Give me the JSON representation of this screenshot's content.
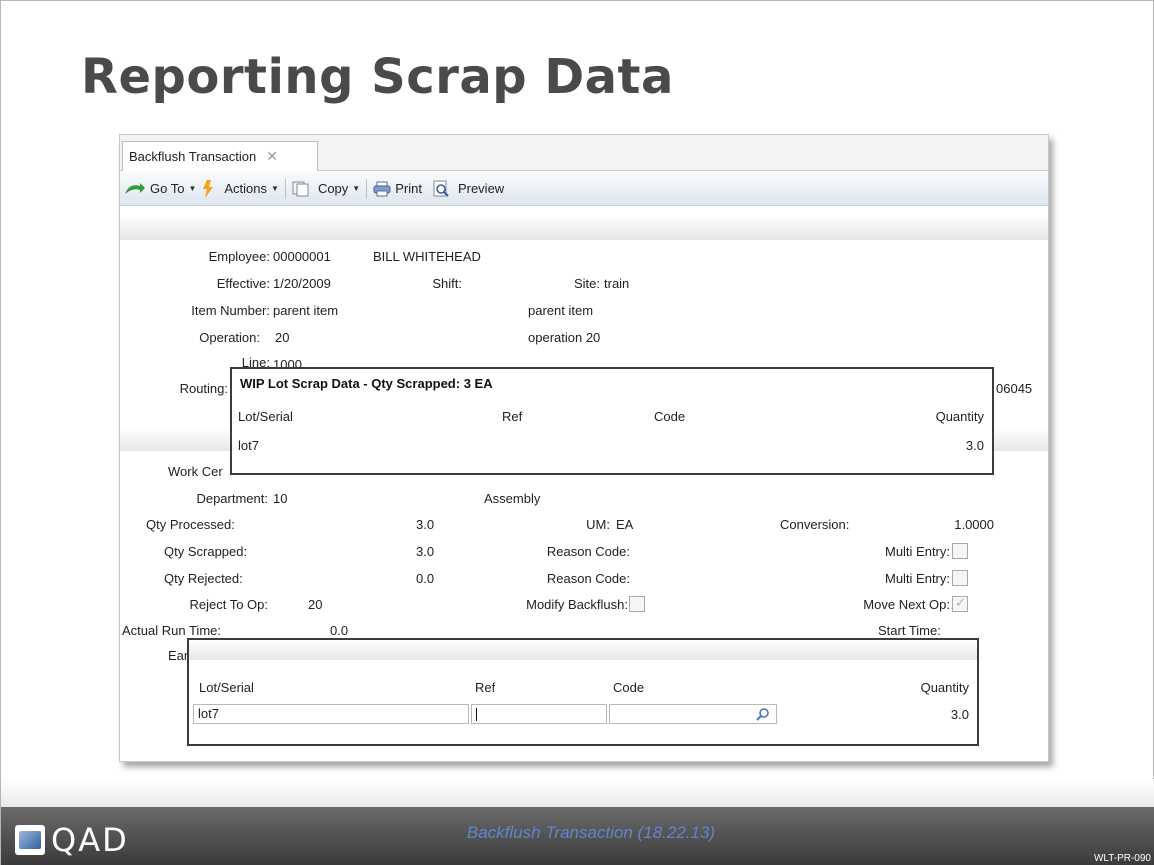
{
  "slide": {
    "title": "Reporting Scrap Data",
    "footer_logo": "QAD",
    "footer_caption": "Backflush Transaction (18.22.13)",
    "footer_code": "WLT-PR-090"
  },
  "window": {
    "tab_label": "Backflush Transaction",
    "tab_close": "✕",
    "toolbar": {
      "goto": "Go To",
      "actions": "Actions",
      "copy": "Copy",
      "print": "Print",
      "preview": "Preview"
    }
  },
  "form": {
    "employee_label": "Employee:",
    "employee_value": "00000001",
    "employee_name": "BILL WHITEHEAD",
    "effective_label": "Effective:",
    "effective_value": "1/20/2009",
    "shift_label": "Shift:",
    "site_label": "Site:",
    "site_value": "train",
    "item_label": "Item Number:",
    "item_value": "parent item",
    "item_desc": "parent item",
    "operation_label": "Operation:",
    "operation_value": "20",
    "operation_desc": "operation 20",
    "line_label": "Line:",
    "line_value": "1000",
    "routing_label": "Routing:",
    "routing_trailing": "06045",
    "workcenter_label": "Work Cer",
    "department_label": "Department:",
    "department_value": "10",
    "department_desc": "Assembly",
    "qty_processed_label": "Qty Processed:",
    "qty_processed_value": "3.0",
    "um_label": "UM:",
    "um_value": "EA",
    "conversion_label": "Conversion:",
    "conversion_value": "1.0000",
    "qty_scrapped_label": "Qty Scrapped:",
    "qty_scrapped_value": "3.0",
    "reason_code_label_1": "Reason Code:",
    "multi_entry_label_1": "Multi Entry:",
    "qty_rejected_label": "Qty Rejected:",
    "qty_rejected_value": "0.0",
    "reason_code_label_2": "Reason Code:",
    "multi_entry_label_2": "Multi Entry:",
    "reject_to_op_label": "Reject To Op:",
    "reject_to_op_value": "20",
    "modify_backflush_label": "Modify Backflush:",
    "move_next_op_label": "Move Next Op:",
    "actual_run_time_label": "Actual Run Time:",
    "actual_run_time_value": "0.0",
    "start_time_label": "Start Time:",
    "earned_label": "Ear"
  },
  "popup_top": {
    "title": "WIP Lot Scrap Data - Qty Scrapped: 3 EA",
    "headers": [
      "Lot/Serial",
      "Ref",
      "Code",
      "Quantity"
    ],
    "row": {
      "lot": "lot7",
      "quantity": "3.0"
    }
  },
  "popup_bottom": {
    "headers": [
      "Lot/Serial",
      "Ref",
      "Code",
      "Quantity"
    ],
    "row": {
      "lot": "lot7",
      "ref": "",
      "code": "",
      "quantity": "3.0"
    }
  }
}
